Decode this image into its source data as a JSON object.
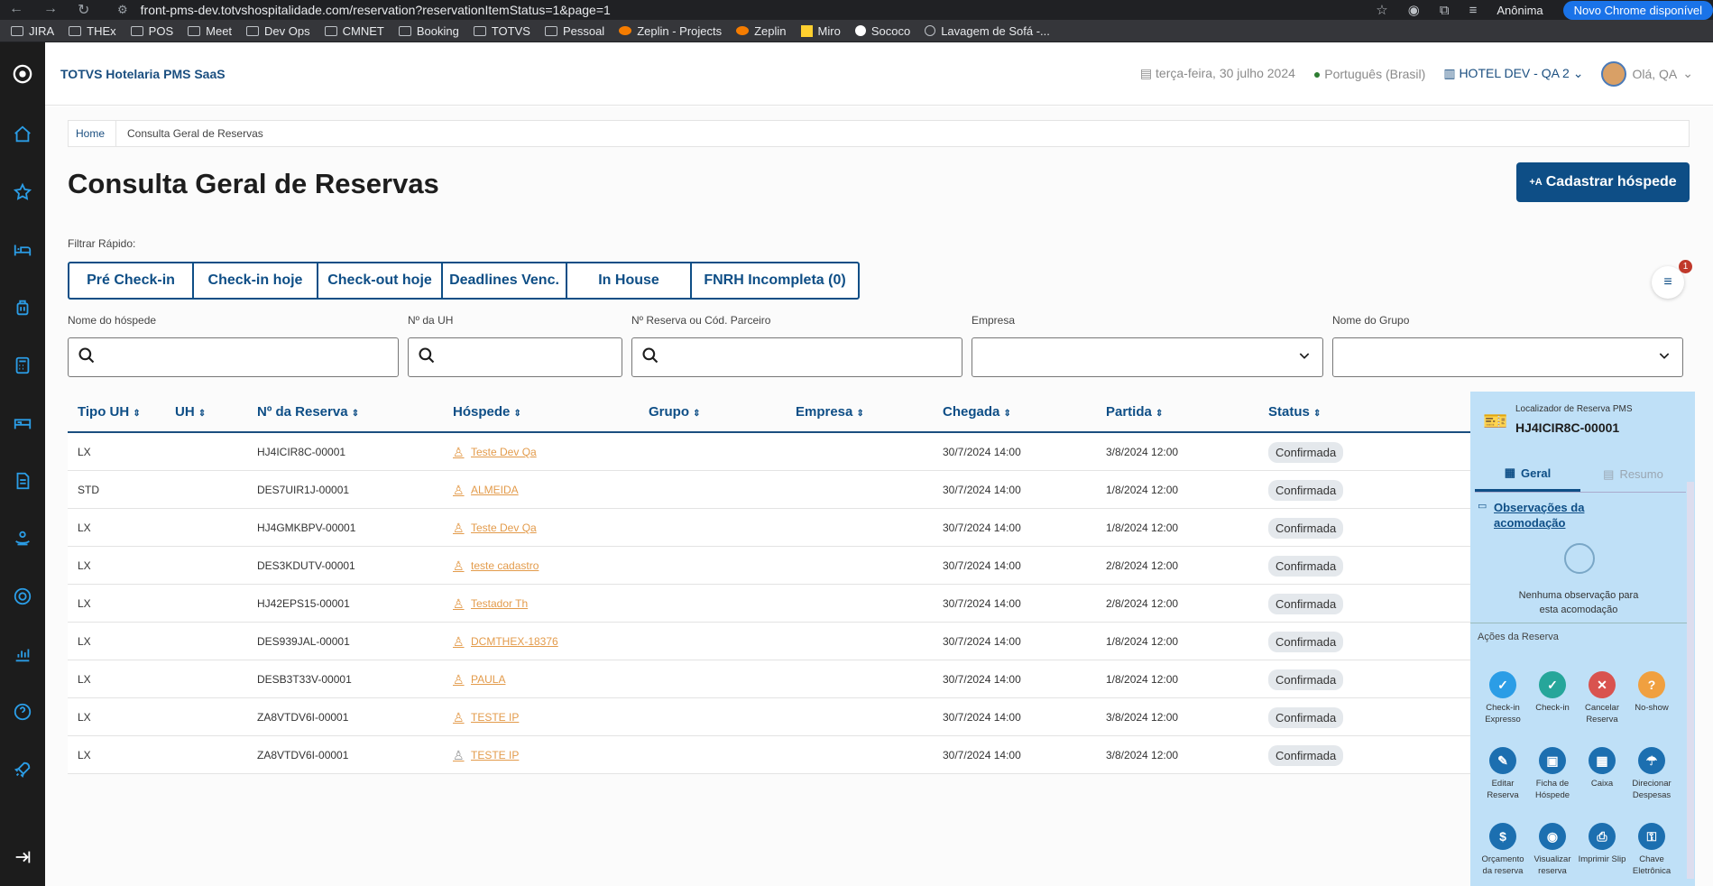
{
  "browser": {
    "url": "front-pms-dev.totvshospitalidade.com/reservation?reservationItemStatus=1&page=1",
    "incognito": "Anônima",
    "update": "Novo Chrome disponível"
  },
  "bookmarks": [
    "JIRA",
    "THEx",
    "POS",
    "Meet",
    "Dev Ops",
    "CMNET",
    "Booking",
    "TOTVS",
    "Pessoal",
    "Zeplin - Projects",
    "Zeplin",
    "Miro",
    "Sococo",
    "Lavagem de Sofá -..."
  ],
  "header": {
    "brand": "TOTVS Hotelaria PMS SaaS",
    "date": "terça-feira, 30 julho 2024",
    "language": "Português (Brasil)",
    "hotel": "HOTEL DEV - QA 2",
    "user": "Olá, QA"
  },
  "breadcrumb": {
    "home": "Home",
    "current": "Consulta Geral de Reservas"
  },
  "page_title": "Consulta Geral de Reservas",
  "register_button": "Cadastrar hóspede",
  "quick_filter": {
    "label": "Filtrar Rápido:",
    "buttons": [
      "Pré Check-in",
      "Check-in hoje",
      "Check-out hoje",
      "Deadlines Venc.",
      "In House",
      "FNRH Incompleta (0)"
    ],
    "badge": "1"
  },
  "filters": {
    "guest": "Nome do hóspede",
    "uh": "Nº da UH",
    "reservation": "Nº Reserva ou Cód. Parceiro",
    "company": "Empresa",
    "group": "Nome do Grupo"
  },
  "table": {
    "headers": [
      "Tipo UH",
      "UH",
      "Nº da Reserva",
      "Hóspede",
      "Grupo",
      "Empresa",
      "Chegada",
      "Partida",
      "Status"
    ],
    "rows": [
      [
        "LX",
        "",
        "HJ4ICIR8C-00001",
        "Teste Dev Qa",
        "",
        "",
        "30/7/2024 14:00",
        "3/8/2024 12:00",
        "Confirmada"
      ],
      [
        "STD",
        "",
        "DES7UIR1J-00001",
        "ALMEIDA",
        "",
        "",
        "30/7/2024 14:00",
        "1/8/2024 12:00",
        "Confirmada"
      ],
      [
        "LX",
        "",
        "HJ4GMKBPV-00001",
        "Teste Dev Qa",
        "",
        "",
        "30/7/2024 14:00",
        "1/8/2024 12:00",
        "Confirmada"
      ],
      [
        "LX",
        "",
        "DES3KDUTV-00001",
        "teste cadastro",
        "",
        "",
        "30/7/2024 14:00",
        "2/8/2024 12:00",
        "Confirmada"
      ],
      [
        "LX",
        "",
        "HJ42EPS15-00001",
        "Testador Th",
        "",
        "",
        "30/7/2024 14:00",
        "2/8/2024 12:00",
        "Confirmada"
      ],
      [
        "LX",
        "",
        "DES939JAL-00001",
        "DCMTHEX-18376",
        "",
        "",
        "30/7/2024 14:00",
        "1/8/2024 12:00",
        "Confirmada"
      ],
      [
        "LX",
        "",
        "DESB3T33V-00001",
        "PAULA",
        "",
        "",
        "30/7/2024 14:00",
        "1/8/2024 12:00",
        "Confirmada"
      ],
      [
        "LX",
        "",
        "ZA8VTDV6I-00001",
        "TESTE IP",
        "",
        "",
        "30/7/2024 14:00",
        "3/8/2024 12:00",
        "Confirmada"
      ],
      [
        "LX",
        "",
        "ZA8VTDV6I-00001",
        "TESTE IP",
        "",
        "",
        "30/7/2024 14:00",
        "3/8/2024 12:00",
        "Confirmada"
      ]
    ]
  },
  "panel": {
    "locator_label": "Localizador de Reserva PMS",
    "locator": "HJ4ICIR8C-00001",
    "tab_general": "Geral",
    "tab_summary": "Resumo",
    "obs_title": "Observações da acomodação",
    "obs_none": "Nenhuma observação para esta acomodação",
    "actions_title": "Ações da Reserva",
    "actions": [
      "Check-in Expresso",
      "Check-in",
      "Cancelar Reserva",
      "No-show",
      "Editar Reserva",
      "Ficha de Hóspede",
      "Caixa",
      "Direcionar Despesas",
      "Orçamento da reserva",
      "Visualizar reserva",
      "Imprimir Slip",
      "Chave Eletrônica"
    ]
  },
  "colors": {
    "primary": "#0e4e86",
    "panel": "#bfe0f7",
    "accent": "#2b9de6",
    "link": "#e39b4b"
  }
}
